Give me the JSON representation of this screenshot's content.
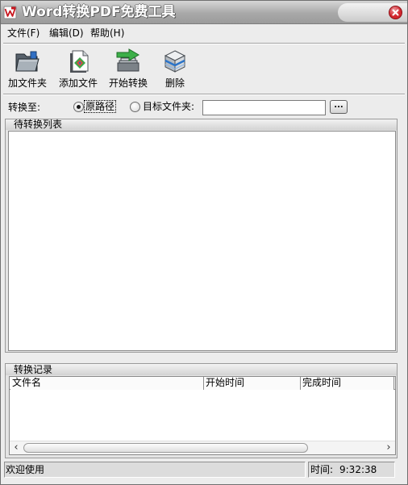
{
  "window": {
    "title": "Word转换PDF免费工具",
    "app_icon": "word-to-pdf-app-icon",
    "close_icon": "close-icon"
  },
  "colors": {
    "close_button": "#d3262e"
  },
  "menu": {
    "items": [
      {
        "label": "文件(F)"
      },
      {
        "label": "编辑(D)"
      },
      {
        "label": "帮助(H)"
      }
    ]
  },
  "toolbar": {
    "buttons": [
      {
        "label": "加文件夹",
        "icon": "folder-icon"
      },
      {
        "label": "添加文件",
        "icon": "add-file-icon"
      },
      {
        "label": "开始转换",
        "icon": "convert-icon"
      },
      {
        "label": "删除",
        "icon": "delete-icon"
      }
    ]
  },
  "destination": {
    "label": "转换至:",
    "options": [
      {
        "label": "原路径",
        "selected": true
      },
      {
        "label": "目标文件夹:",
        "selected": false
      }
    ],
    "folder_path": "",
    "browse_label": "..."
  },
  "pending_list": {
    "title": "待转换列表",
    "items": []
  },
  "conversion_log": {
    "title": "转换记录",
    "columns": [
      "文件名",
      "开始时间",
      "完成时间"
    ],
    "rows": []
  },
  "status_bar": {
    "message": "欢迎使用",
    "time_label": "时间:",
    "time_value": "9:32:38"
  }
}
